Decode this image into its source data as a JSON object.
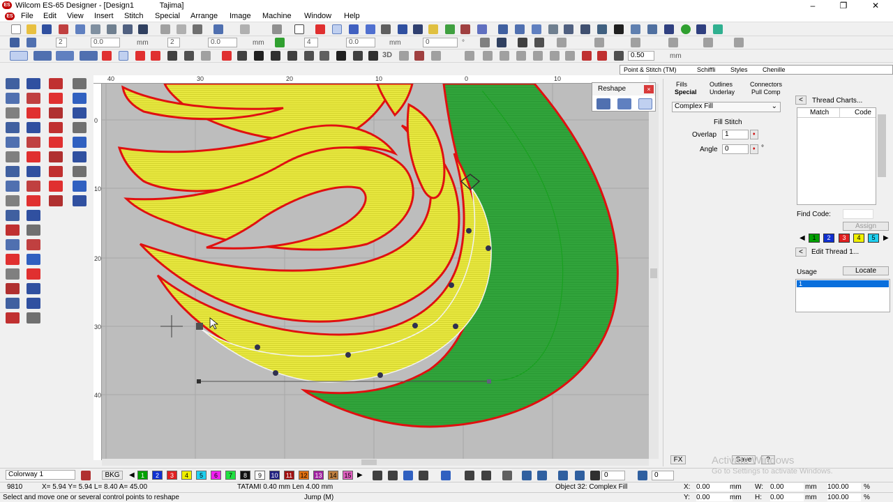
{
  "window": {
    "app_title": "Wilcom ES-65 Designer - [Design1",
    "machine": "Tajima]",
    "icon_text": "ES",
    "minimize": "–",
    "maximize": "❐",
    "close": "✕"
  },
  "menus": [
    "File",
    "Edit",
    "View",
    "Insert",
    "Stitch",
    "Special",
    "Arrange",
    "Image",
    "Machine",
    "Window",
    "Help"
  ],
  "toolbar2": {
    "field1": "2",
    "field2": "0.0",
    "unit1": "mm",
    "field3": "2",
    "field4": "0.0",
    "unit2": "mm",
    "field5": "4",
    "field6": "0.0",
    "unit3": "mm",
    "field7": "0",
    "unit4": "°"
  },
  "toolbar3": {
    "label3d": "3D",
    "zoom_value": "0.50",
    "zoom_unit": "mm"
  },
  "ruler": {
    "top_labels": [
      "40",
      "30",
      "20",
      "10",
      "0",
      "10"
    ],
    "left_labels": [
      "0",
      "10",
      "20",
      "30",
      "40"
    ]
  },
  "reshape": {
    "title": "Reshape",
    "close": "×"
  },
  "panel_tabs": [
    "Point & Stitch (TM)",
    "Schiffli",
    "Styles",
    "Chenille"
  ],
  "props": {
    "tabs_top": [
      "Fills",
      "Outlines",
      "Connectors"
    ],
    "tabs_bottom": [
      "Special",
      "Underlay",
      "Pull Comp"
    ],
    "fill_type": "Complex Fill",
    "fill_stitch": "Fill Stitch",
    "overlap_label": "Overlap",
    "overlap_value": "1",
    "angle_label": "Angle",
    "angle_value": "0",
    "angle_unit": "°",
    "fx": "FX",
    "save": "Save",
    "help": "?"
  },
  "thread": {
    "charts_label": "Thread Charts...",
    "col_match": "Match",
    "col_code": "Code",
    "find_code": "Find Code:",
    "assign": "Assign",
    "swatches": [
      "1",
      "2",
      "3",
      "4",
      "5"
    ],
    "edit_thread": "Edit Thread 1...",
    "usage": "Usage",
    "locate": "Locate",
    "usage_item": "1"
  },
  "colorbar": {
    "colorway": "Colorway 1",
    "bkg": "BKG",
    "swatches": [
      {
        "n": "1",
        "c": "#00a000"
      },
      {
        "n": "2",
        "c": "#1030d0"
      },
      {
        "n": "3",
        "c": "#e02020"
      },
      {
        "n": "4",
        "c": "#f0f000"
      },
      {
        "n": "5",
        "c": "#20d0f0"
      },
      {
        "n": "6",
        "c": "#f020f0"
      },
      {
        "n": "7",
        "c": "#20e040"
      },
      {
        "n": "8",
        "c": "#101010"
      },
      {
        "n": "9",
        "c": "#ffffff"
      },
      {
        "n": "10",
        "c": "#202080"
      },
      {
        "n": "11",
        "c": "#a01010"
      },
      {
        "n": "12",
        "c": "#e07010"
      },
      {
        "n": "13",
        "c": "#a020a0"
      },
      {
        "n": "14",
        "c": "#c08040"
      },
      {
        "n": "15",
        "c": "#e060c0"
      }
    ],
    "field_a": "0",
    "field_b": "0"
  },
  "status": {
    "stitches": "9810",
    "coords": "X= 5.94 Y= 5.94 L= 8.40 A= 45.00",
    "stitch_info": "TATAMI 0.40 mm Len 4.00 mm",
    "object": "Object 32: Complex Fill",
    "x_label": "X:",
    "x_val": "0.00",
    "y_label": "Y:",
    "y_val": "0.00",
    "w_label": "W:",
    "w_val": "0.00",
    "h_label": "H:",
    "h_val": "0.00",
    "mm": "mm",
    "pct1": "100.00",
    "pct2": "100.00",
    "pct": "%",
    "hint": "Select and move one or several control points to reshape",
    "jump": "Jump (M)"
  },
  "watermark": {
    "line1": "Activate Windows",
    "line2": "Go to Settings to activate Windows."
  },
  "colors": {
    "red_outline": "#e01010",
    "yellow_fill": "#e8e840",
    "green_fill": "#2fa03a",
    "canvas_bg": "#bdbdbd"
  }
}
